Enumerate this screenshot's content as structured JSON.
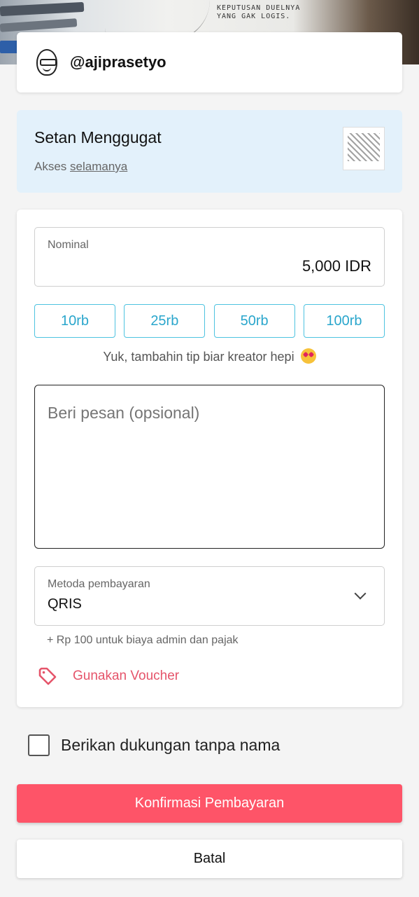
{
  "creator": {
    "username": "@ajiprasetyo"
  },
  "product": {
    "title": "Setan Menggugat",
    "access_prefix": "Akses",
    "access_link": "selamanya"
  },
  "form": {
    "nominal_label": "Nominal",
    "nominal_value": "5,000 IDR",
    "tip_chips": [
      "10rb",
      "25rb",
      "50rb",
      "100rb"
    ],
    "tip_text": "Yuk, tambahin tip biar kreator hepi",
    "message_placeholder": "Beri pesan (opsional)",
    "payment_label": "Metoda pembayaran",
    "payment_value": "QRIS",
    "fee_note": "+ Rp 100 untuk biaya admin dan pajak",
    "voucher_label": "Gunakan Voucher"
  },
  "anonymous": {
    "label": "Berikan dukungan tanpa nama",
    "checked": false
  },
  "actions": {
    "confirm_label": "Konfirmasi Pembayaran",
    "cancel_label": "Batal"
  },
  "banner": {
    "note_line1": "KEPUTUSAN DUELNYA",
    "note_line2": "YANG GAK LOGIS."
  },
  "colors": {
    "accent": "#fe5468",
    "chip": "#2aa6cc",
    "product_bg": "#e3f1fb"
  }
}
